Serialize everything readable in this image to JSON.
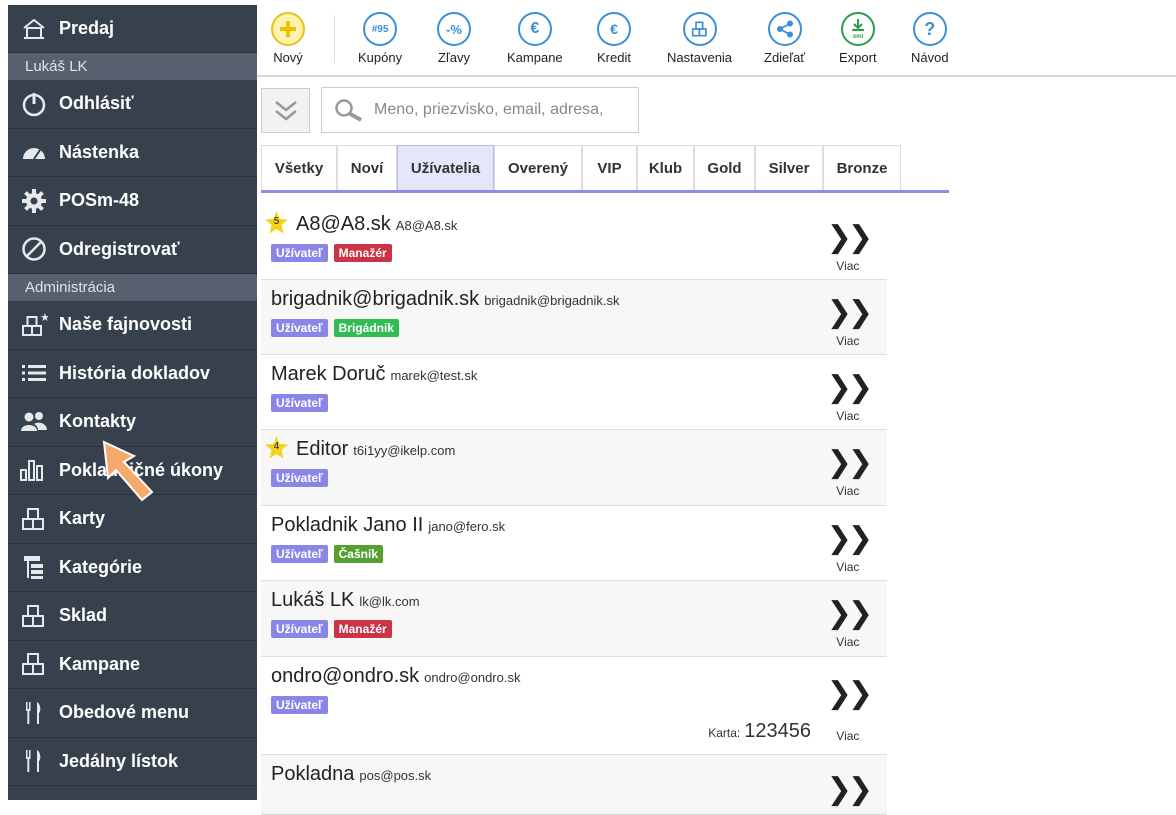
{
  "sidebar": {
    "top_items": [
      {
        "label": "Predaj",
        "icon": "home-icon"
      }
    ],
    "user_section": "Lukáš LK",
    "user_items": [
      {
        "label": "Odhlásiť",
        "icon": "power-icon"
      },
      {
        "label": "Nástenka",
        "icon": "dashboard-icon"
      },
      {
        "label": "POSm-48",
        "icon": "gear-icon"
      },
      {
        "label": "Odregistrovať",
        "icon": "block-icon"
      }
    ],
    "admin_section": "Administrácia",
    "admin_items": [
      {
        "label": "Naše fajnovosti",
        "icon": "boxes-star-icon"
      },
      {
        "label": "História dokladov",
        "icon": "list-icon"
      },
      {
        "label": "Kontakty",
        "icon": "users-icon"
      },
      {
        "label": "Pokladničné úkony",
        "icon": "bar-chart-icon"
      },
      {
        "label": "Karty",
        "icon": "boxes-icon"
      },
      {
        "label": "Kategórie",
        "icon": "tree-icon"
      },
      {
        "label": "Sklad",
        "icon": "boxes-icon"
      },
      {
        "label": "Kampane",
        "icon": "boxes-icon"
      },
      {
        "label": "Obedové menu",
        "icon": "cutlery-icon"
      },
      {
        "label": "Jedálny lístok",
        "icon": "cutlery-icon"
      }
    ]
  },
  "toolbar": {
    "buttons": [
      {
        "label": "Nový",
        "icon": "plus-icon",
        "glyph": "+"
      },
      {
        "label": "Kupóny",
        "icon": "coupon-icon",
        "glyph": "#95"
      },
      {
        "label": "Zľavy",
        "icon": "percent-icon",
        "glyph": "-%"
      },
      {
        "label": "Kampane",
        "icon": "euro-campaign-icon",
        "glyph": "€"
      },
      {
        "label": "Kredit",
        "icon": "euro-credit-icon",
        "glyph": "€"
      },
      {
        "label": "Nastavenia",
        "icon": "boxes-icon",
        "glyph": "⊞"
      },
      {
        "label": "Zdieľať",
        "icon": "share-icon",
        "glyph": "<"
      },
      {
        "label": "Export",
        "icon": "export-xml-icon",
        "glyph": "↓"
      },
      {
        "label": "Návod",
        "icon": "help-icon",
        "glyph": "?"
      }
    ]
  },
  "search": {
    "placeholder": "Meno, priezvisko, email, adresa,"
  },
  "tabs": [
    {
      "label": "Všetky"
    },
    {
      "label": "Noví"
    },
    {
      "label": "Užívatelia",
      "active": true
    },
    {
      "label": "Overený"
    },
    {
      "label": "VIP"
    },
    {
      "label": "Klub"
    },
    {
      "label": "Gold"
    },
    {
      "label": "Silver"
    },
    {
      "label": "Bronze"
    }
  ],
  "contacts": [
    {
      "name": "A8@A8.sk",
      "email": "A8@A8.sk",
      "star": "5",
      "badges": [
        "Užívateľ",
        "Manažér"
      ],
      "more": "Viac"
    },
    {
      "name": "brigadnik@brigadnik.sk",
      "email": "brigadnik@brigadnik.sk",
      "badges": [
        "Užívateľ",
        "Brigádnik"
      ],
      "more": "Viac"
    },
    {
      "name": "Marek Doruč",
      "email": "marek@test.sk",
      "badges": [
        "Užívateľ"
      ],
      "more": "Viac"
    },
    {
      "name": "Editor",
      "email": "t6i1yy@ikelp.com",
      "star": "4",
      "badges": [
        "Užívateľ"
      ],
      "more": "Viac"
    },
    {
      "name": "Pokladnik Jano II",
      "email": "jano@fero.sk",
      "badges": [
        "Užívateľ",
        "Čašník"
      ],
      "more": "Viac"
    },
    {
      "name": "Lukáš LK",
      "email": "lk@lk.com",
      "badges": [
        "Užívateľ",
        "Manažér"
      ],
      "more": "Viac"
    },
    {
      "name": "ondro@ondro.sk",
      "email": "ondro@ondro.sk",
      "badges": [
        "Užívateľ"
      ],
      "card_label": "Karta:",
      "card_number": "123456",
      "more": "Viac"
    },
    {
      "name": "Pokladna",
      "email": "pos@pos.sk",
      "badges": [],
      "more": "Viac"
    }
  ],
  "colors": {
    "sidebar_bg": "#37404d",
    "accent_blue": "#3b8fd6",
    "badge_user": "#8a86e8",
    "badge_manager": "#cc3344",
    "badge_brigadnik": "#33bb55",
    "badge_casnik": "#55a030",
    "tab_active": "#e6e6fa",
    "cursor": "#f5a96a"
  }
}
